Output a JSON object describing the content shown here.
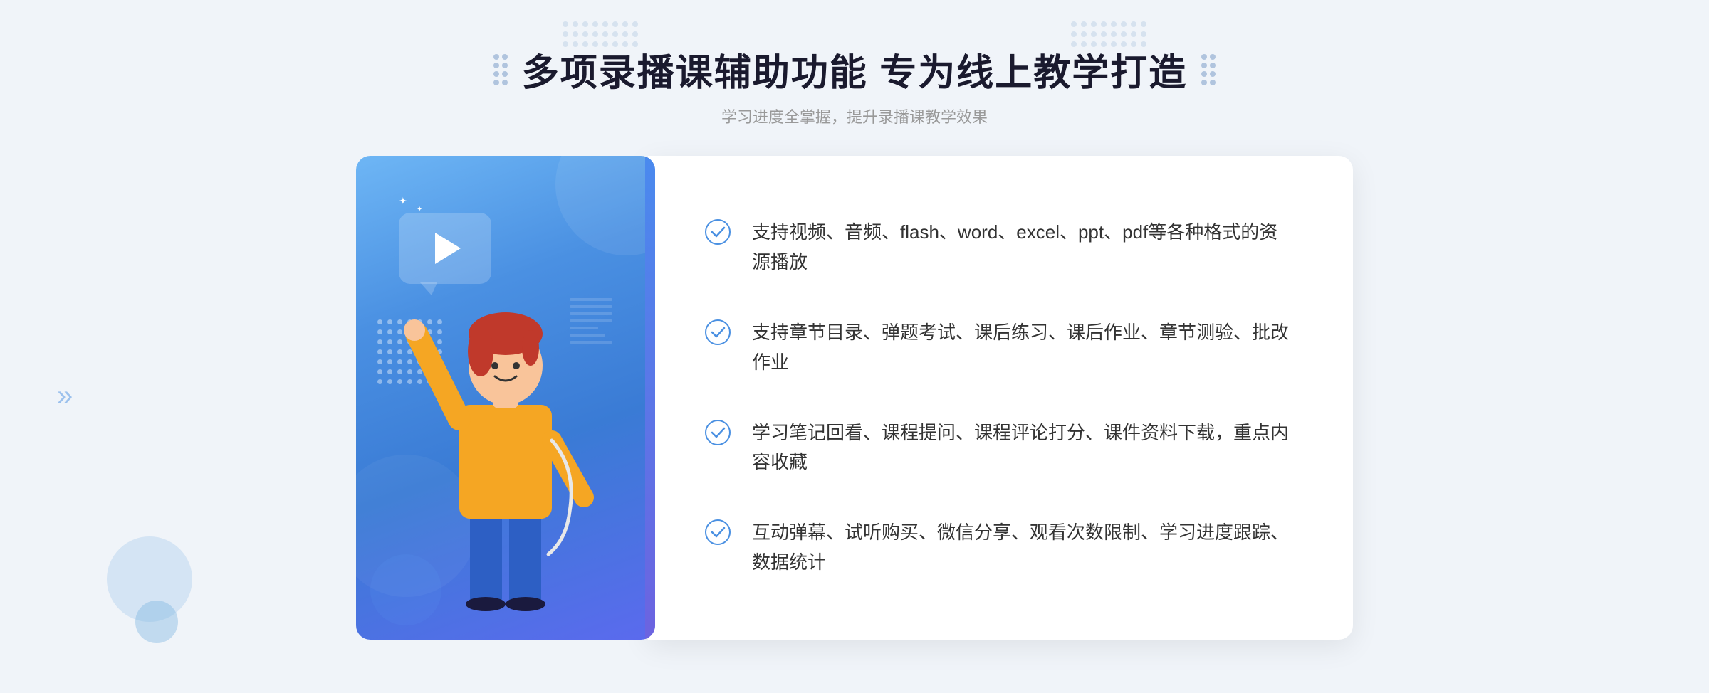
{
  "header": {
    "title": "多项录播课辅助功能 专为线上教学打造",
    "subtitle": "学习进度全掌握，提升录播课教学效果"
  },
  "features": [
    {
      "id": "feature-1",
      "text": "支持视频、音频、flash、word、excel、ppt、pdf等各种格式的资源播放"
    },
    {
      "id": "feature-2",
      "text": "支持章节目录、弹题考试、课后练习、课后作业、章节测验、批改作业"
    },
    {
      "id": "feature-3",
      "text": "学习笔记回看、课程提问、课程评论打分、课件资料下载，重点内容收藏"
    },
    {
      "id": "feature-4",
      "text": "互动弹幕、试听购买、微信分享、观看次数限制、学习进度跟踪、数据统计"
    }
  ],
  "decorations": {
    "left_arrow": "»",
    "check_color": "#4a90e2"
  }
}
